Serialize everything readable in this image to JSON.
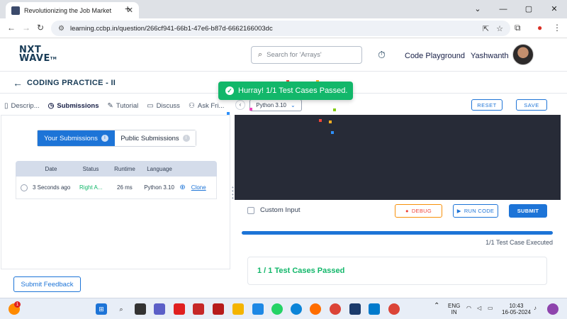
{
  "browser": {
    "tab_title": "Revolutionizing the Job Market",
    "tab_close": "✕",
    "new_tab": "+",
    "url": "learning.ccbp.in/question/266cf941-66b1-47e6-b87d-6662166003dc",
    "window_controls": [
      "⌄",
      "—",
      "▢",
      "✕"
    ]
  },
  "header": {
    "logo_line1": "NXT",
    "logo_line2": "WAVE",
    "logo_tm": "TM",
    "search_placeholder": "Search for 'Arrays'",
    "playground_label": "Code Playground",
    "user_name": "Yashwanth"
  },
  "practice": {
    "title": "CODING PRACTICE - II"
  },
  "toast": {
    "message": "Hurray! 1/1 Test Cases Passed."
  },
  "left_tabs": [
    {
      "label": "Descrip..."
    },
    {
      "label": "Submissions"
    },
    {
      "label": "Tutorial"
    },
    {
      "label": "Discuss"
    },
    {
      "label": "Ask Fri..."
    }
  ],
  "submissions_toggle": {
    "yours": "Your Submissions",
    "public": "Public Submissions",
    "info": "i"
  },
  "submissions_table": {
    "headers": [
      "Date",
      "Status",
      "Runtime",
      "Language"
    ],
    "rows": [
      {
        "date": "3 Seconds ago",
        "status": "Right A...",
        "runtime": "26 ms",
        "language": "Python 3.10",
        "action": "Clone"
      }
    ]
  },
  "feedback_label": "Submit Feedback",
  "editor": {
    "language": "Python 3.10",
    "reset_label": "RESET",
    "save_label": "SAVE",
    "custom_input_label": "Custom Input",
    "debug_label": "DEBUG",
    "run_label": "RUN CODE",
    "submit_label": "SUBMIT",
    "progress_fraction": 1.0,
    "executed_text": "1/1 Test Case Executed",
    "result_text": "1 / 1 Test Cases Passed"
  },
  "taskbar": {
    "notification_count": "1",
    "lang_line1": "ENG",
    "lang_line2": "IN",
    "time": "10:43",
    "date": "16-05-2024"
  },
  "colors": {
    "primary": "#1d74d7",
    "success": "#12b76a",
    "editor_bg": "#272b37",
    "brand_dark": "#183b56"
  }
}
